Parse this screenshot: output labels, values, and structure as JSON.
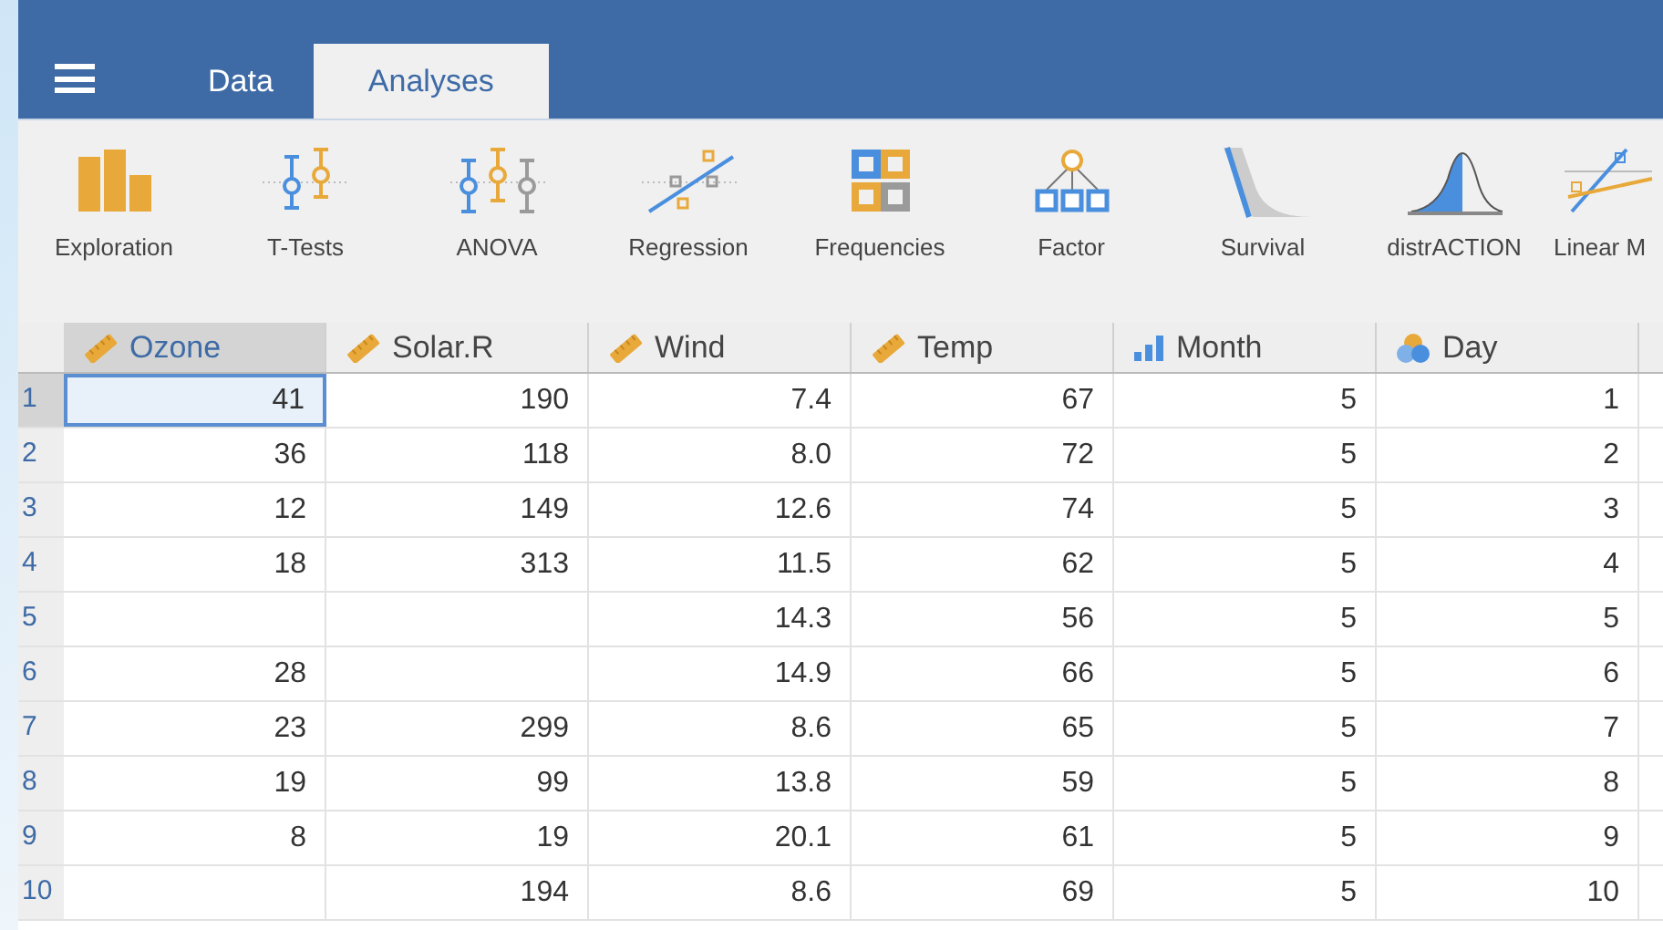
{
  "tabs": [
    {
      "label": "Data",
      "selected": false
    },
    {
      "label": "Analyses",
      "selected": true
    }
  ],
  "toolbar": [
    {
      "label": "Exploration",
      "kind": "exploration"
    },
    {
      "label": "T-Tests",
      "kind": "ttests"
    },
    {
      "label": "ANOVA",
      "kind": "anova"
    },
    {
      "label": "Regression",
      "kind": "regression"
    },
    {
      "label": "Frequencies",
      "kind": "frequencies"
    },
    {
      "label": "Factor",
      "kind": "factor"
    },
    {
      "label": "Survival",
      "kind": "survival"
    },
    {
      "label": "distrACTION",
      "kind": "distribution"
    },
    {
      "label": "Linear M",
      "kind": "linear"
    }
  ],
  "table": {
    "columns": [
      {
        "name": "Ozone",
        "kind": "continuous",
        "selected": true
      },
      {
        "name": "Solar.R",
        "kind": "continuous",
        "selected": false
      },
      {
        "name": "Wind",
        "kind": "continuous",
        "selected": false
      },
      {
        "name": "Temp",
        "kind": "continuous",
        "selected": false
      },
      {
        "name": "Month",
        "kind": "ordinal",
        "selected": false
      },
      {
        "name": "Day",
        "kind": "nominal",
        "selected": false
      }
    ],
    "rows": [
      {
        "number": "1",
        "cells": [
          "41",
          "190",
          "7.4",
          "67",
          "5",
          "1"
        ],
        "selected": true
      },
      {
        "number": "2",
        "cells": [
          "36",
          "118",
          "8.0",
          "72",
          "5",
          "2"
        ],
        "selected": false
      },
      {
        "number": "3",
        "cells": [
          "12",
          "149",
          "12.6",
          "74",
          "5",
          "3"
        ],
        "selected": false
      },
      {
        "number": "4",
        "cells": [
          "18",
          "313",
          "11.5",
          "62",
          "5",
          "4"
        ],
        "selected": false
      },
      {
        "number": "5",
        "cells": [
          null,
          null,
          "14.3",
          "56",
          "5",
          "5"
        ],
        "selected": false
      },
      {
        "number": "6",
        "cells": [
          "28",
          null,
          "14.9",
          "66",
          "5",
          "6"
        ],
        "selected": false
      },
      {
        "number": "7",
        "cells": [
          "23",
          "299",
          "8.6",
          "65",
          "5",
          "7"
        ],
        "selected": false
      },
      {
        "number": "8",
        "cells": [
          "19",
          "99",
          "13.8",
          "59",
          "5",
          "8"
        ],
        "selected": false
      },
      {
        "number": "9",
        "cells": [
          "8",
          "19",
          "20.1",
          "61",
          "5",
          "9"
        ],
        "selected": false
      },
      {
        "number": "10",
        "cells": [
          null,
          "194",
          "8.6",
          "69",
          "5",
          "10"
        ],
        "selected": false
      }
    ]
  }
}
